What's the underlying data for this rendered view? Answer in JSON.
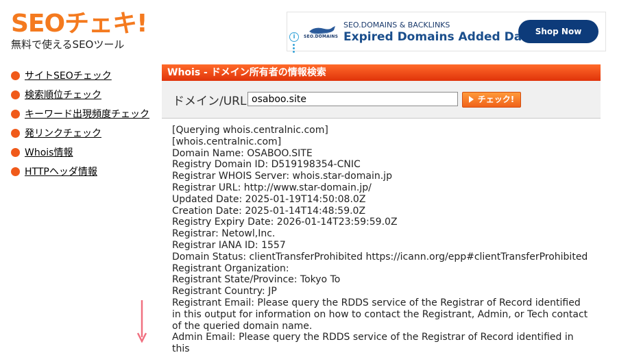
{
  "logo": {
    "main_latin": "SEO",
    "main_jp": "チェキ!",
    "tagline": "無料で使えるSEOツール"
  },
  "ad": {
    "info_icon": "info-icon",
    "brand_text": "SEO.DOMAINS",
    "top_line": "SEO.DOMAINS & BACKLINKS",
    "headline": "Expired Domains Added Daily",
    "button_label": "Shop Now",
    "button_color": "#0d3b7a"
  },
  "sidebar": {
    "bullet_color": "#f05a1a",
    "items": [
      {
        "label": "サイトSEOチェック"
      },
      {
        "label": "検索順位チェック"
      },
      {
        "label": "キーワード出現頻度チェック"
      },
      {
        "label": "発リンクチェック"
      },
      {
        "label": "Whois情報"
      },
      {
        "label": "HTTPヘッダ情報"
      }
    ]
  },
  "panel": {
    "title": "Whois - ドメイン所有者の情報検索",
    "accent_color": "#f05a1a",
    "form_label": "ドメイン/URL",
    "input_value": "osaboo.site",
    "check_button": "チェック!"
  },
  "whois_lines": [
    "[Querying whois.centralnic.com]",
    "[whois.centralnic.com]",
    "Domain Name: OSABOO.SITE",
    "Registry Domain ID: D519198354-CNIC",
    "Registrar WHOIS Server: whois.star-domain.jp",
    "Registrar URL: http://www.star-domain.jp/",
    "Updated Date: 2025-01-19T14:50:08.0Z",
    "Creation Date: 2025-01-14T14:48:59.0Z",
    "Registry Expiry Date: 2026-01-14T23:59:59.0Z",
    "Registrar: Netowl,Inc.",
    "Registrar IANA ID: 1557",
    "Domain Status: clientTransferProhibited https://icann.org/epp#clientTransferProhibited",
    "Registrant Organization:",
    "Registrant State/Province: Tokyo To",
    "Registrant Country: JP",
    "Registrant Email: Please query the RDDS service of the Registrar of Record identified in this output for information on how to contact the Registrant, Admin, or Tech contact of the queried domain name.",
    "Admin Email: Please query the RDDS service of the Registrar of Record identified in this"
  ],
  "annotation": {
    "icon": "arrow-down-icon",
    "color": "#f07080"
  }
}
